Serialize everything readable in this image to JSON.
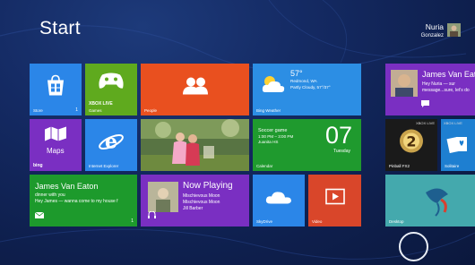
{
  "screen": {
    "title": "Start"
  },
  "user": {
    "first_name": "Nuria",
    "last_name": "Gonzalez"
  },
  "tiles": {
    "store": {
      "label": "Store",
      "badge": "1",
      "color": "#2b86e8"
    },
    "xbox": {
      "logo": "XBOX LIVE",
      "label": "Games",
      "color": "#5faa1e"
    },
    "people": {
      "label": "People",
      "color": "#e9501f"
    },
    "weather": {
      "temp": "57°",
      "city": "Redmond, WA",
      "cond": "Partly Cloudy, 57°/37°",
      "label": "Bing Weather",
      "color": "#2c8ee4"
    },
    "maps": {
      "name": "Maps",
      "label": "bing",
      "color": "#7a2fc2"
    },
    "ie": {
      "label": "Internet Explorer",
      "color": "#2b86e8"
    },
    "photos": {
      "label": "Photos"
    },
    "calendar": {
      "event": "Soccer game",
      "time": "1:00 PM – 3:00 PM",
      "place": "Juanita HS",
      "day": "07",
      "weekday": "Tuesday",
      "label": "Calendar",
      "color": "#1f9a2e"
    },
    "mail": {
      "from": "James Van Eaton",
      "subject": "dinner with you",
      "preview": "Hey James — wanna come to my house f",
      "badge": "1",
      "color": "#1d9a2c"
    },
    "music": {
      "heading": "Now Playing",
      "track": "Mischievous Moon",
      "album": "Mischievous Moon",
      "artist": "Jill Barber",
      "color": "#7a2fc2"
    },
    "skydrive": {
      "label": "SkyDrive",
      "color": "#2b86e8"
    },
    "video": {
      "label": "Video",
      "color": "#d9462a"
    },
    "messaging": {
      "from": "James Van Eat",
      "line1": "Hey Nuria — sur",
      "line2": "message...sure, let's do",
      "color": "#7a2fc2"
    },
    "game": {
      "label": "Pinball FX2",
      "xbox": "XBOX LIVE"
    },
    "solitaire": {
      "label": "Solitaire",
      "xbox": "XBOX LIVE",
      "color": "#1e7fd1"
    },
    "desktop": {
      "label": "Desktop",
      "color": "#3aa0a6"
    }
  }
}
